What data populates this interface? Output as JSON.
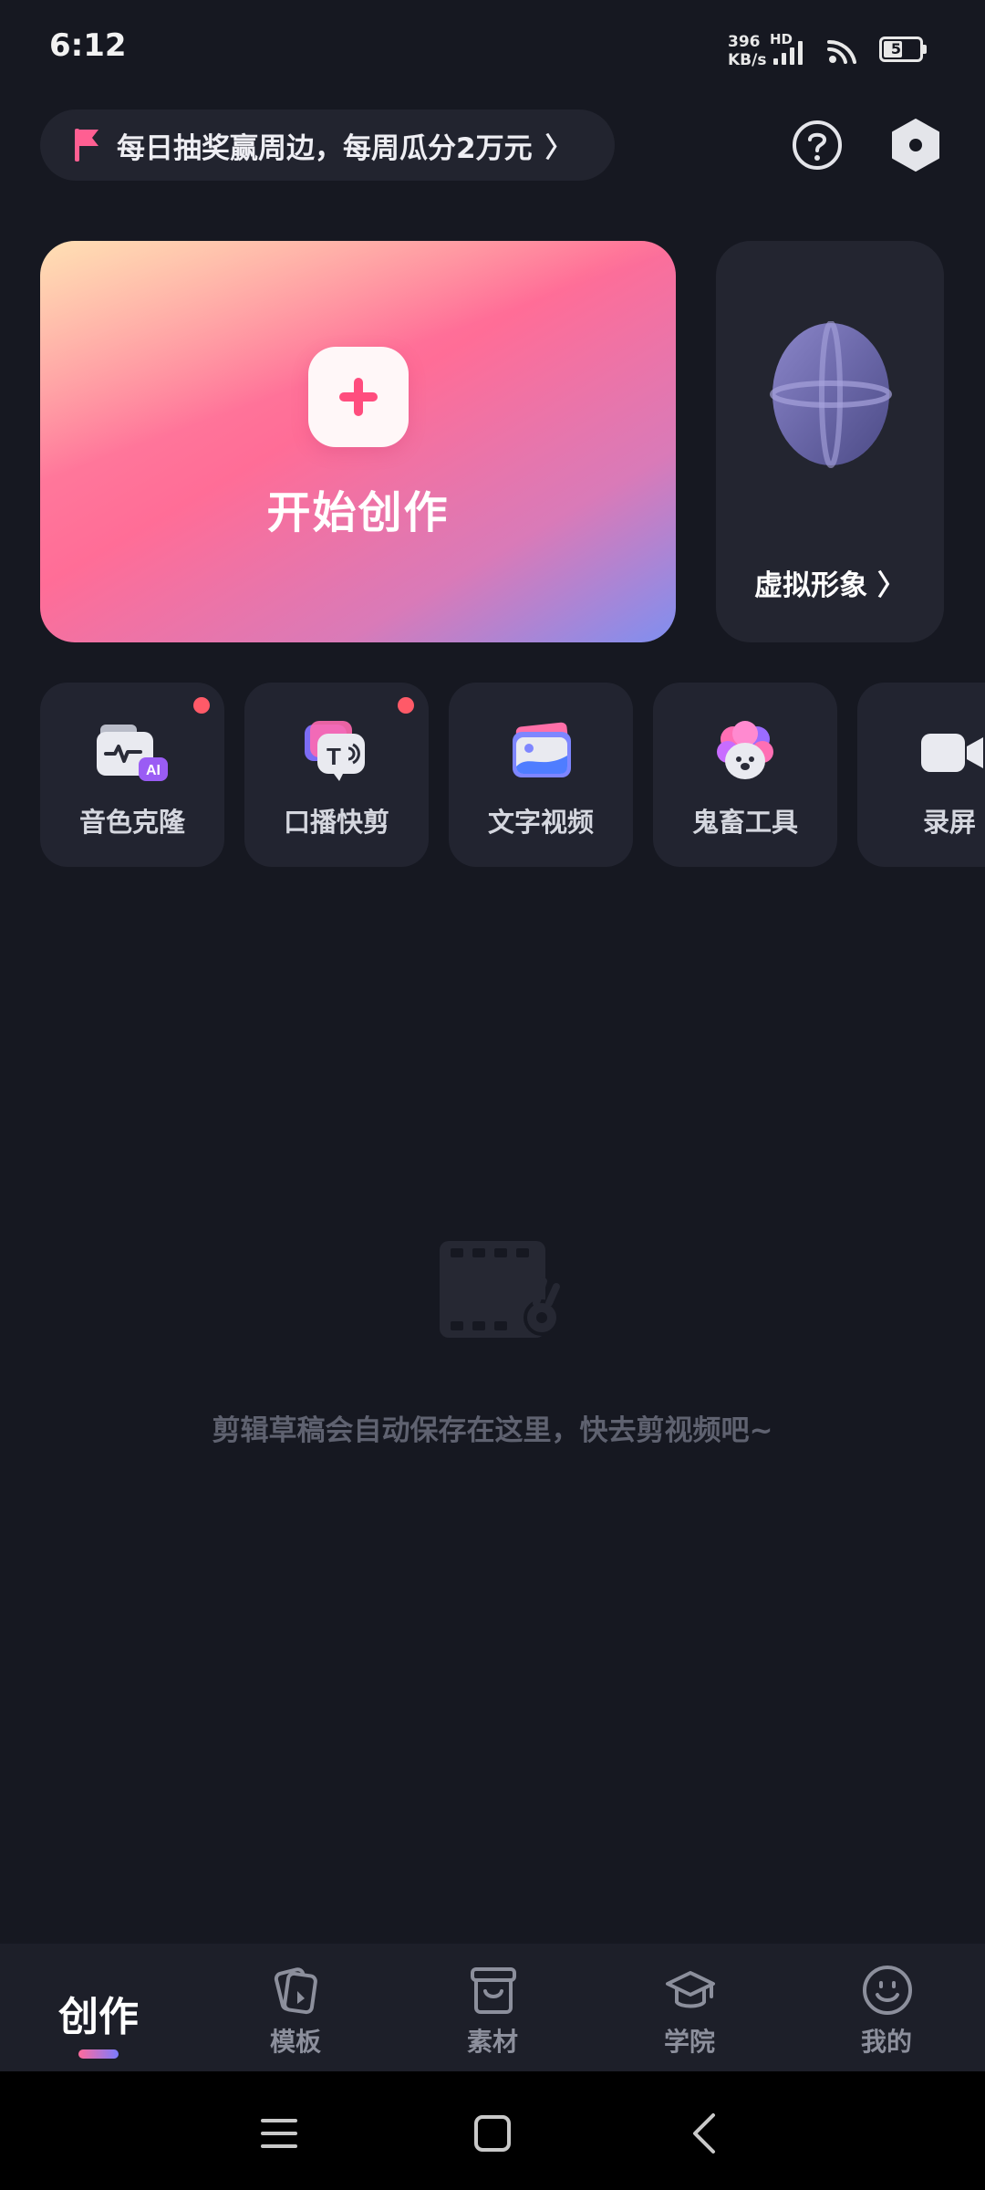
{
  "status_bar": {
    "time": "6:12",
    "net_speed_value": "396",
    "net_speed_unit": "KB/s",
    "network_type": "HD",
    "battery_level": "52",
    "battery_fraction": 0.52
  },
  "promo": {
    "text": "每日抽奖赢周边，每周瓜分2万元",
    "chevron": "〉",
    "icon": "flag-icon",
    "flag_color": "#ff5f92"
  },
  "header_actions": {
    "help_icon": "question-circle-icon",
    "settings_icon": "hexagon-settings-icon"
  },
  "create_card": {
    "label": "开始创作",
    "icon": "plus-icon",
    "accent": "#ff4d7e"
  },
  "avatar_card": {
    "label": "虚拟形象 〉",
    "icon": "avatar-head-icon"
  },
  "tools": [
    {
      "label": "音色克隆",
      "icon": "voice-clone-icon",
      "badge": true
    },
    {
      "label": "口播快剪",
      "icon": "talking-text-icon",
      "badge": true
    },
    {
      "label": "文字视频",
      "icon": "image-text-icon",
      "badge": false
    },
    {
      "label": "鬼畜工具",
      "icon": "cute-face-icon",
      "badge": false
    },
    {
      "label": "录屏",
      "icon": "video-camera-icon",
      "badge": false
    }
  ],
  "empty_state": {
    "text": "剪辑草稿会自动保存在这里，快去剪视频吧~",
    "icon": "film-scissors-icon"
  },
  "bottom_nav": [
    {
      "label": "创作",
      "icon": "create-icon",
      "active": true
    },
    {
      "label": "模板",
      "icon": "template-cards-icon",
      "active": false
    },
    {
      "label": "素材",
      "icon": "store-icon",
      "active": false
    },
    {
      "label": "学院",
      "icon": "graduation-cap-icon",
      "active": false
    },
    {
      "label": "我的",
      "icon": "smile-icon",
      "active": false
    }
  ],
  "system_nav": {
    "menu_icon": "menu-icon",
    "home_icon": "home-square-icon",
    "back_icon": "back-chevron-icon"
  }
}
